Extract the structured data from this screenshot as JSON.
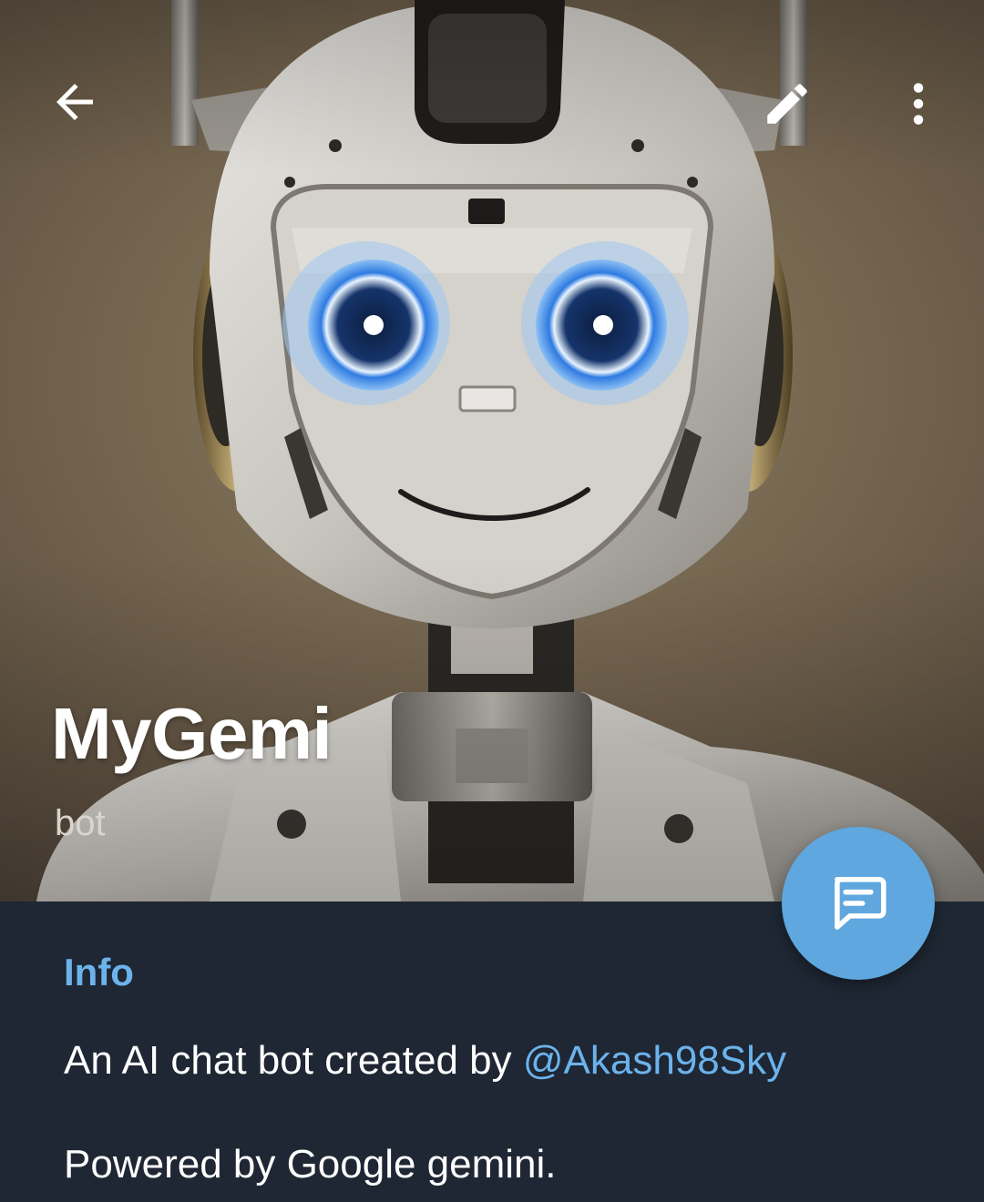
{
  "profile": {
    "name": "MyGemi",
    "status": "bot"
  },
  "toolbar": {
    "back_icon": "arrow-left-icon",
    "edit_icon": "pencil-icon",
    "more_icon": "more-vertical-icon"
  },
  "fab": {
    "icon": "message-icon"
  },
  "info": {
    "heading": "Info",
    "description_prefix": "An AI chat bot created by ",
    "description_mention": "@Akash98Sky",
    "description_line2": "Powered by Google gemini."
  },
  "colors": {
    "background": "#1e2733",
    "accent": "#6cb3ec",
    "fab": "#5fa7de",
    "text": "#ffffff"
  }
}
